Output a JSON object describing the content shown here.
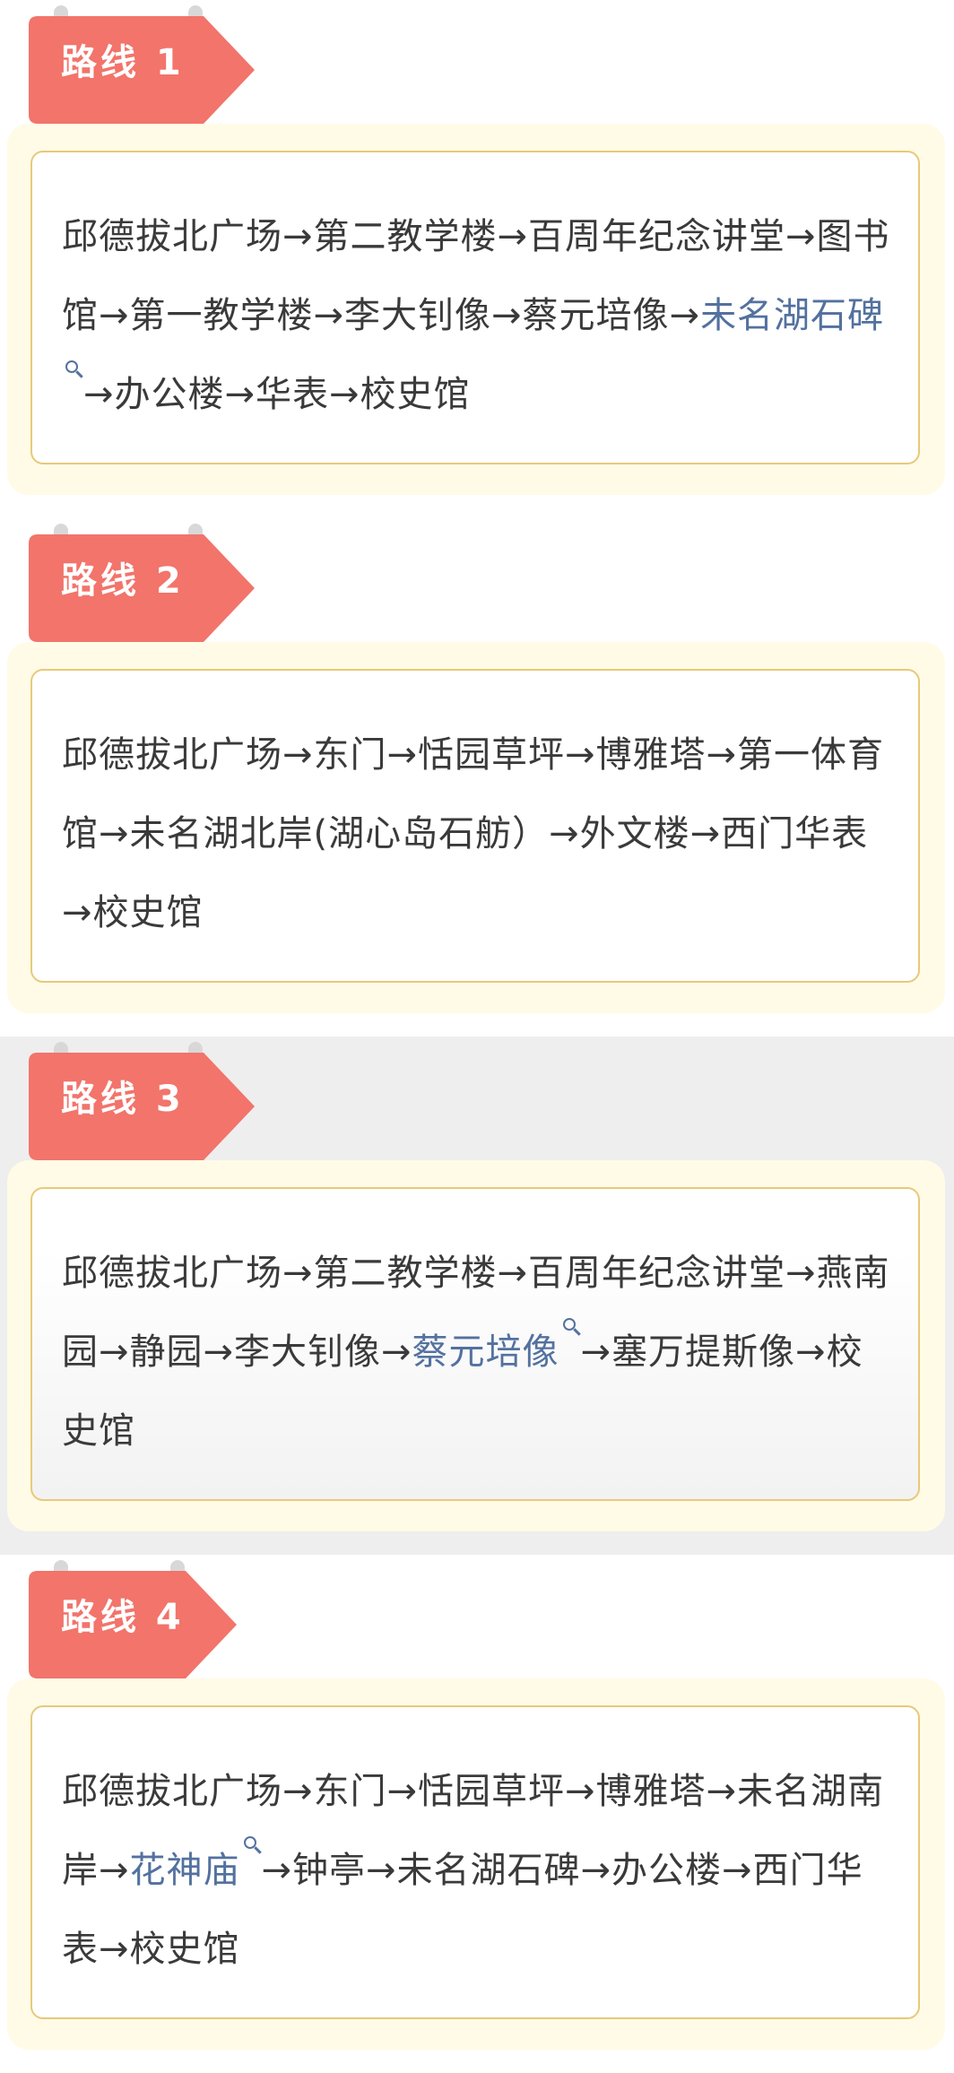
{
  "routes": [
    {
      "label": "路线 1",
      "segments": [
        {
          "text": "邱德拔北广场→第二教学楼→百周年纪念讲堂→图书馆→第一教学楼→李大钊像→蔡元培像→"
        },
        {
          "text": "未名湖石碑",
          "link": true
        },
        {
          "text": "→办公楼→华表→校史馆"
        }
      ]
    },
    {
      "label": "路线 2",
      "segments": [
        {
          "text": "邱德拔北广场→东门→恬园草坪→博雅塔→第一体育馆→未名湖北岸(湖心岛石舫）→外文楼→西门华表→校史馆"
        }
      ]
    },
    {
      "label": "路线 3",
      "segments": [
        {
          "text": "邱德拔北广场→第二教学楼→百周年纪念讲堂→燕南园→静园→李大钊像→"
        },
        {
          "text": "蔡元培像",
          "link": true
        },
        {
          "text": "→塞万提斯像→校史馆"
        }
      ]
    },
    {
      "label": "路线 4",
      "segments": [
        {
          "text": "邱德拔北广场→东门→恬园草坪→博雅塔→未名湖南岸→"
        },
        {
          "text": "花神庙",
          "link": true
        },
        {
          "text": "→钟亭→未名湖石碑→办公楼→西门华表→校史馆"
        }
      ]
    }
  ],
  "colors": {
    "sign": "#f2746b",
    "card_border": "#e8c97a",
    "card_bg": "#fffbe7",
    "link": "#53719f",
    "text": "#3a3a3a"
  },
  "icons": {
    "sign_shape": "pennant-arrow-sign",
    "link_marker": "search-icon"
  }
}
